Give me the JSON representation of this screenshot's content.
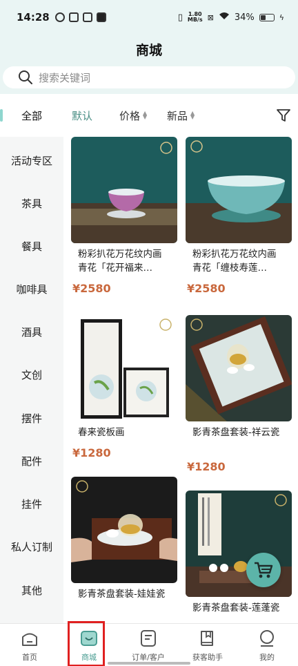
{
  "status": {
    "time": "14:28",
    "speed_value": "1.80",
    "speed_unit": "MB/s",
    "battery": "34%"
  },
  "header": {
    "title": "商城",
    "search_placeholder": "搜索关键词"
  },
  "filters": {
    "all": "全部",
    "default": "默认",
    "price": "价格",
    "new": "新品"
  },
  "categories": [
    "活动专区",
    "茶具",
    "餐具",
    "咖啡具",
    "酒具",
    "文创",
    "摆件",
    "配件",
    "挂件",
    "私人订制",
    "其他"
  ],
  "products": [
    {
      "name": "粉彩扒花万花纹内画青花「花开福来…",
      "price": "¥2580"
    },
    {
      "name": "粉彩扒花万花纹内画青花「缠枝寿莲…",
      "price": "¥2580"
    },
    {
      "name": "春来瓷板画",
      "price": "¥1280"
    },
    {
      "name": "影青茶盘套装-祥云瓷",
      "price": "¥1280"
    },
    {
      "name": "影青茶盘套装-娃娃瓷",
      "price": ""
    },
    {
      "name": "影青茶盘套装-莲蓬瓷",
      "price": ""
    }
  ],
  "nav": [
    {
      "label": "首页",
      "icon": "home-icon"
    },
    {
      "label": "商城",
      "icon": "shop-bag-icon"
    },
    {
      "label": "订单/客户",
      "icon": "order-icon"
    },
    {
      "label": "获客助手",
      "icon": "book-icon"
    },
    {
      "label": "我的",
      "icon": "profile-icon"
    }
  ],
  "colors": {
    "accent": "#4a9d92",
    "price": "#c9683d",
    "header_bg": "#eaf5f4",
    "highlight": "#e02020"
  }
}
